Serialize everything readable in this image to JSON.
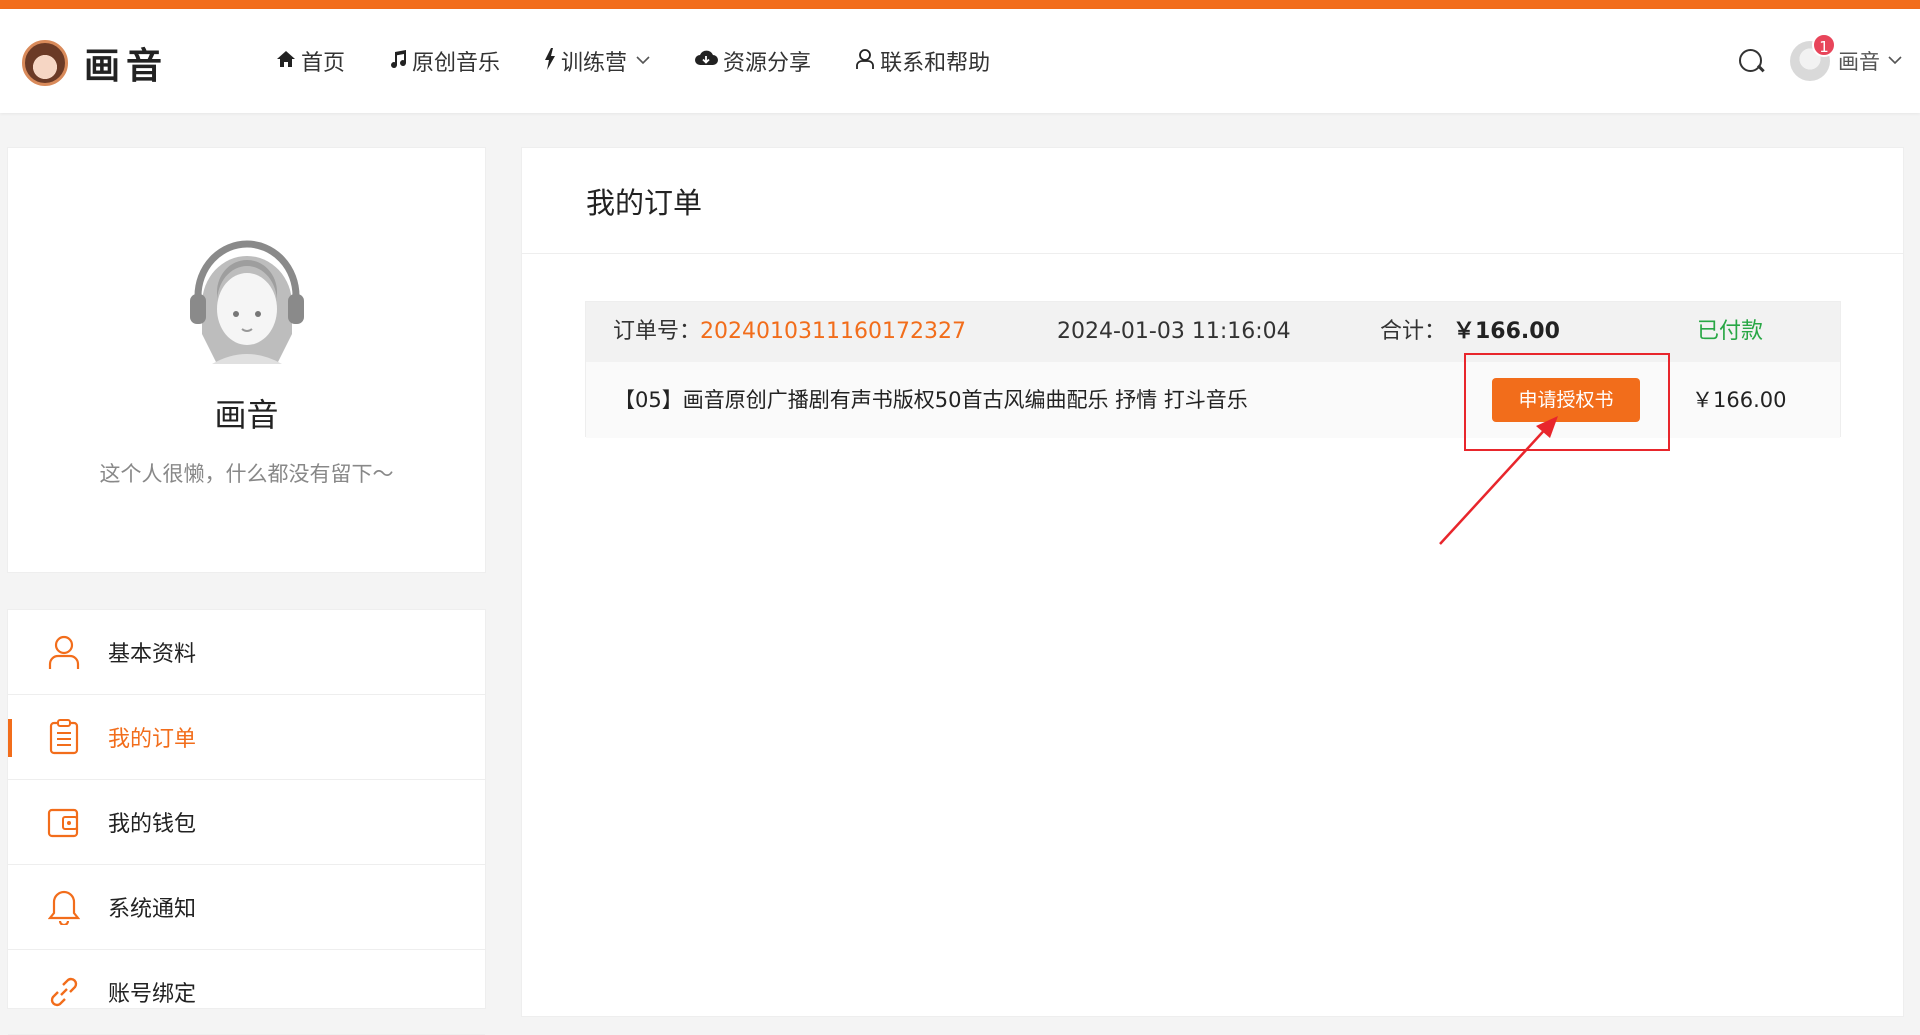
{
  "site": {
    "logo_text": "画音"
  },
  "nav": {
    "items": [
      {
        "icon": "home-icon",
        "label": "首页"
      },
      {
        "icon": "music-note-icon",
        "label": "原创音乐"
      },
      {
        "icon": "lightning-icon",
        "label": "训练营",
        "dropdown": true
      },
      {
        "icon": "cloud-download-icon",
        "label": "资源分享"
      },
      {
        "icon": "user-outline-icon",
        "label": "联系和帮助"
      }
    ]
  },
  "user": {
    "name": "画音",
    "notification_count": "1"
  },
  "profile": {
    "name": "画音",
    "bio": "这个人很懒，什么都没有留下～"
  },
  "sidebar": {
    "items": [
      {
        "label": "基本资料",
        "icon": "user-icon",
        "active": false
      },
      {
        "label": "我的订单",
        "icon": "clipboard-icon",
        "active": true
      },
      {
        "label": "我的钱包",
        "icon": "wallet-icon",
        "active": false
      },
      {
        "label": "系统通知",
        "icon": "bell-icon",
        "active": false
      },
      {
        "label": "账号绑定",
        "icon": "link-icon",
        "active": false
      }
    ]
  },
  "main": {
    "title": "我的订单",
    "order": {
      "order_no_label": "订单号：",
      "order_no": "20240103111601723​27",
      "time": "2024-01-03 11:16:04",
      "total_label": "合计：",
      "total": "￥166.00",
      "status": "已付款",
      "product_name": "【05】画音原创广播剧有声书版权50首古风编曲配乐 抒情 打斗音乐",
      "apply_button_label": "申请授权书",
      "item_price": "￥166.00"
    }
  },
  "colors": {
    "accent": "#f26d1b",
    "paid": "#28a745",
    "annotation": "#e8262c"
  }
}
